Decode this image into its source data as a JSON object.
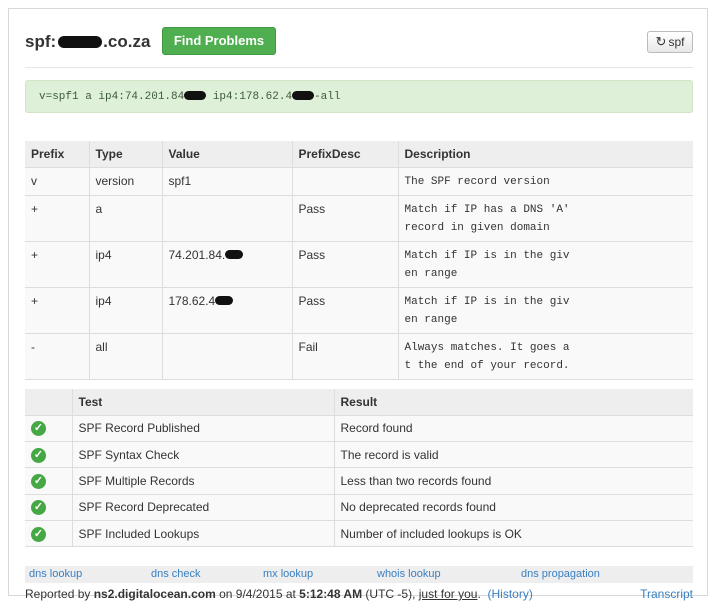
{
  "header": {
    "domain_prefix": "spf:",
    "domain_suffix": ".co.za",
    "find_button": "Find Problems",
    "spf_button": "spf",
    "refresh_icon": "↻"
  },
  "record": {
    "part1": "v=spf1 a ip4:74.201.84",
    "part2": " ip4:178.62.4",
    "part3": "-all"
  },
  "mechanisms": {
    "columns": [
      "Prefix",
      "Type",
      "Value",
      "PrefixDesc",
      "Description"
    ],
    "rows": [
      {
        "prefix": "v",
        "type": "version",
        "value": "spf1",
        "prefix_desc": "",
        "description": "The SPF record version"
      },
      {
        "prefix": "+",
        "type": "a",
        "value": "",
        "prefix_desc": "Pass",
        "description_l1": "Match if IP has a DNS 'A'",
        "description_l2": "record in given domain"
      },
      {
        "prefix": "+",
        "type": "ip4",
        "value": "74.201.84.",
        "prefix_desc": "Pass",
        "description_l1": "Match if IP is in the giv",
        "description_l2": "en range"
      },
      {
        "prefix": "+",
        "type": "ip4",
        "value": "178.62.4",
        "prefix_desc": "Pass",
        "description_l1": "Match if IP is in the giv",
        "description_l2": "en range"
      },
      {
        "prefix": "-",
        "type": "all",
        "value": "",
        "prefix_desc": "Fail",
        "description_l1": "Always matches. It goes a",
        "description_l2": "t the end of your record."
      }
    ]
  },
  "tests": {
    "columns": [
      "",
      "Test",
      "Result"
    ],
    "check_glyph": "✓",
    "rows": [
      {
        "test": "SPF Record Published",
        "result": "Record found"
      },
      {
        "test": "SPF Syntax Check",
        "result": "The record is valid"
      },
      {
        "test": "SPF Multiple Records",
        "result": "Less than two records found"
      },
      {
        "test": "SPF Record Deprecated",
        "result": "No deprecated records found"
      },
      {
        "test": "SPF Included Lookups",
        "result": "Number of included lookups is OK"
      }
    ]
  },
  "links": [
    "dns lookup",
    "dns check",
    "mx lookup",
    "whois lookup",
    "dns propagation"
  ],
  "footer": {
    "reported_by": "Reported by ",
    "server": "ns2.digitalocean.com",
    "on": " on 9/4/2015 at ",
    "time": "5:12:48 AM",
    "tz": " (UTC -5), ",
    "just_for_you": "just for you",
    "dot": ".",
    "history": "(History)",
    "transcript": "Transcript"
  },
  "colors": {
    "accent_green": "#4fae4f",
    "record_bg": "#dff0d8",
    "link_blue": "#3a7fc0"
  }
}
